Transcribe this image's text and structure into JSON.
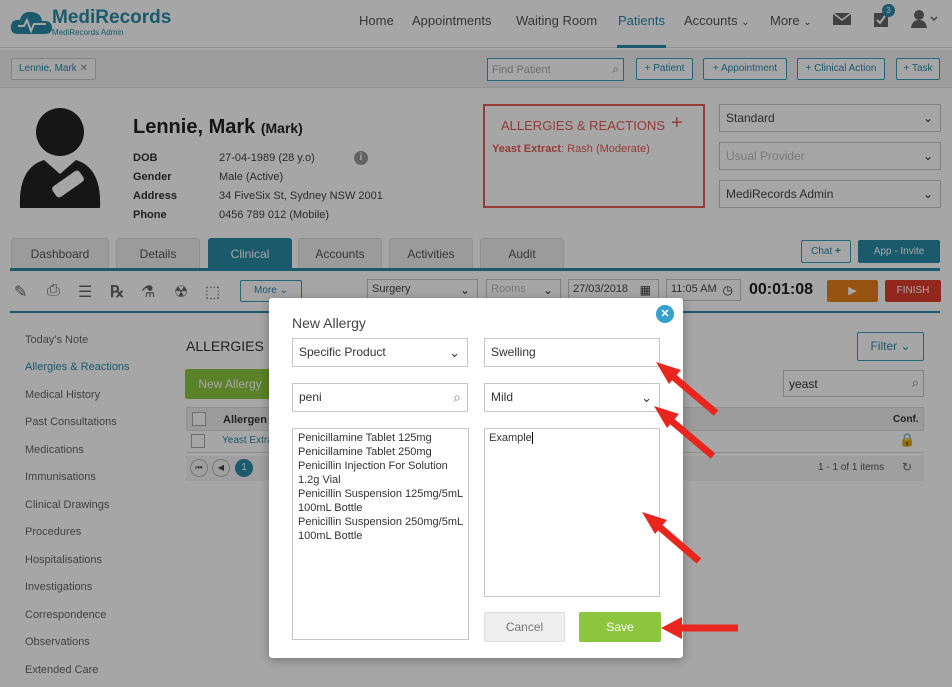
{
  "app": {
    "logo_name": "MediRecords",
    "logo_sub": "MediRecords Admin"
  },
  "nav": {
    "items": [
      "Home",
      "Appointments",
      "Waiting Room",
      "Patients",
      "Accounts",
      "More"
    ],
    "badge": "3"
  },
  "bar2": {
    "patient_chip": "Lennie, Mark",
    "find_placeholder": "Find Patient",
    "buttons": [
      "+ Patient",
      "+ Appointment",
      "+ Clinical Action",
      "+ Task"
    ]
  },
  "patient": {
    "name": "Lennie, Mark",
    "nickname": "(Mark)",
    "fields": [
      {
        "label": "DOB",
        "value": "27-04-1989 (28 y.o)"
      },
      {
        "label": "Gender",
        "value": "Male (Active)"
      },
      {
        "label": "Address",
        "value": "34 FiveSix St, Sydney NSW 2001"
      },
      {
        "label": "Phone",
        "value": "0456 789 012 (Mobile)"
      }
    ]
  },
  "allergies_box": {
    "title": "ALLERGIES & REACTIONS",
    "allergen": "Yeast Extract",
    "reaction": ": Rash (Moderate)"
  },
  "right_selects": [
    "Standard",
    "Usual Provider",
    "MediRecords Admin"
  ],
  "tabs": [
    "Dashboard",
    "Details",
    "Clinical",
    "Accounts",
    "Activities",
    "Audit"
  ],
  "tab_buttons": {
    "chat": "Chat",
    "app_invite": "App - Invite"
  },
  "toolbar": {
    "more": "More",
    "location": "Surgery",
    "rooms": "Rooms",
    "date": "27/03/2018",
    "time": "11:05 AM",
    "timer": "00:01:08",
    "finish": "FINISH"
  },
  "left_menu": [
    "Today's Note",
    "Allergies & Reactions",
    "Medical History",
    "Past Consultations",
    "Medications",
    "Immunisations",
    "Clinical Drawings",
    "Procedures",
    "Hospitalisations",
    "Investigations",
    "Correspondence",
    "Observations",
    "Extended Care"
  ],
  "main": {
    "heading": "ALLERGIES",
    "new_button": "New Allergy",
    "filter": "Filter",
    "search_value": "yeast",
    "col_allergen": "Allergen",
    "col_conf": "Conf.",
    "row_allergen": "Yeast Extra",
    "pager_page": "1",
    "pager_info": "1 - 1 of 1 items"
  },
  "modal": {
    "title": "New Allergy",
    "type_select": "Specific Product",
    "reaction_value": "Swelling",
    "search_value": "peni",
    "severity_select": "Mild",
    "notes_value": "Example",
    "results": [
      "Penicillamine Tablet 125mg",
      "Penicillamine Tablet 250mg",
      "Penicillin Injection For Solution 1.2g Vial",
      "Penicillin Suspension 125mg/5mL 100mL Bottle",
      "Penicillin Suspension 250mg/5mL 100mL Bottle"
    ],
    "cancel": "Cancel",
    "save": "Save"
  },
  "colors": {
    "accent": "#2a8aa8",
    "allergy_red": "#e55b57",
    "green": "#8cc63f",
    "orange": "#e8801c",
    "finish_red": "#e03d2f",
    "arrow_red": "#e8261e"
  }
}
